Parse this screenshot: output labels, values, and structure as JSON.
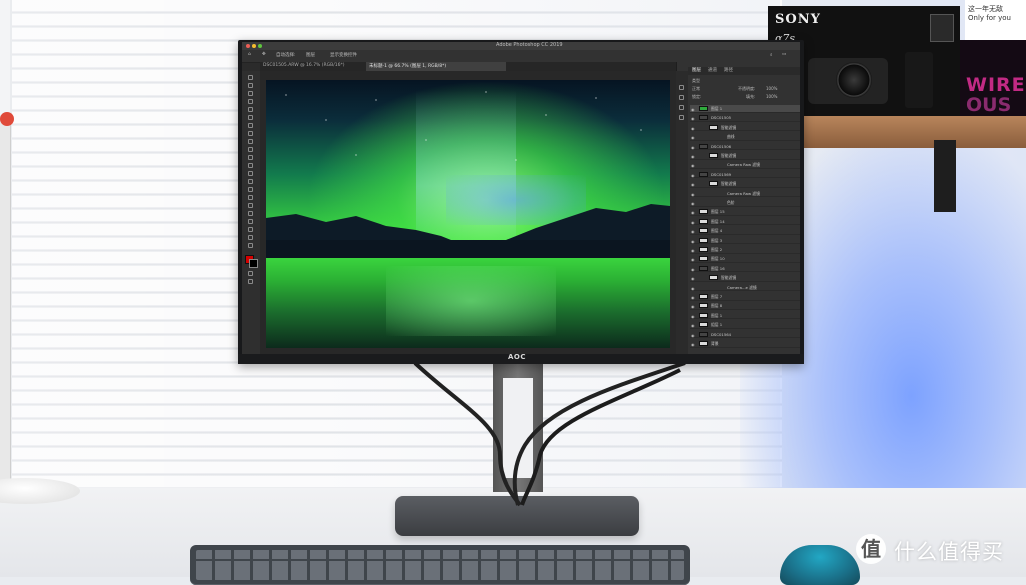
{
  "scene": {
    "camera_box": {
      "brand": "SONY",
      "model": "α7s"
    },
    "box_side_text": [
      "WIREL",
      "OUS"
    ],
    "shelf_note": [
      "这一年无敌",
      "Only for you"
    ],
    "monitor_logo": "AOC"
  },
  "photoshop": {
    "title": "Adobe Photoshop CC 2019",
    "options_bar": [
      "自动选择:",
      "图层",
      "显示变换控件"
    ],
    "tabs": [
      {
        "label": "DSC01505.ARW @ 16.7% (RGB/16*)",
        "active": false
      },
      {
        "label": "未标题-1 @ 66.7% (图层 1, RGB/8*)",
        "active": true
      }
    ],
    "panel_tabs": [
      {
        "label": "图层",
        "active": true
      },
      {
        "label": "通道",
        "active": false
      },
      {
        "label": "路径",
        "active": false
      }
    ],
    "layer_controls": {
      "filter": "类型",
      "blend": "正常",
      "opacity_label": "不透明度:",
      "opacity": "100%",
      "lock_label": "锁定:",
      "fill_label": "填充:",
      "fill": "100%"
    },
    "layers": [
      {
        "name": "图层 1",
        "thumb": "green",
        "selected": true
      },
      {
        "name": "DSC01505",
        "thumb": "dark"
      },
      {
        "name": "智能滤镜",
        "thumb": "white"
      },
      {
        "name": "曲线",
        "thumb": "none"
      },
      {
        "name": "DSC01506",
        "thumb": "dark"
      },
      {
        "name": "智能滤镜",
        "thumb": "white"
      },
      {
        "name": "Camera Raw 滤镜",
        "thumb": "none"
      },
      {
        "name": "DSC01569",
        "thumb": "dark"
      },
      {
        "name": "智能滤镜",
        "thumb": "white"
      },
      {
        "name": "Camera Raw 滤镜",
        "thumb": "none"
      },
      {
        "name": "色阶",
        "thumb": "none"
      },
      {
        "name": "图层 15",
        "thumb": "white"
      },
      {
        "name": "图层 14",
        "thumb": "white"
      },
      {
        "name": "图层 4",
        "thumb": "white"
      },
      {
        "name": "图层 3",
        "thumb": "white"
      },
      {
        "name": "图层 2",
        "thumb": "white"
      },
      {
        "name": "图层 10",
        "thumb": "white"
      },
      {
        "name": "图层 16",
        "thumb": "dark"
      },
      {
        "name": "智能滤镜",
        "thumb": "white"
      },
      {
        "name": "Camera...e 滤镜",
        "thumb": "none"
      },
      {
        "name": "图层 7",
        "thumb": "white"
      },
      {
        "name": "图层 8",
        "thumb": "white"
      },
      {
        "name": "图层 1",
        "thumb": "white"
      },
      {
        "name": "组层 1",
        "thumb": "white"
      },
      {
        "name": "DSC01564",
        "thumb": "dark"
      },
      {
        "name": "背景",
        "thumb": "white"
      }
    ]
  },
  "watermark": {
    "icon": "值",
    "text": "什么值得买"
  }
}
